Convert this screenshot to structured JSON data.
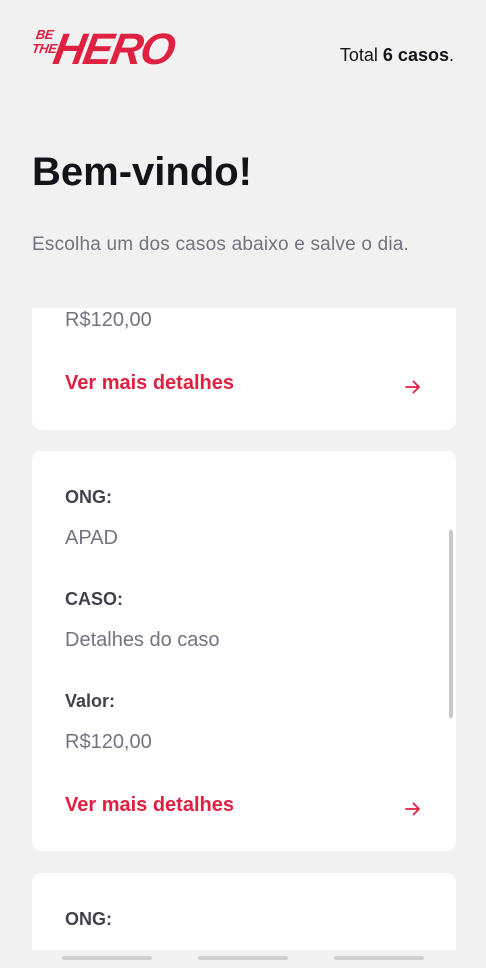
{
  "header": {
    "logo": {
      "be": "BE",
      "the": "THE",
      "hero": "HERO"
    },
    "total_prefix": "Total ",
    "total_count": "6 casos",
    "total_suffix": "."
  },
  "title": "Bem-vindo!",
  "subtitle": "Escolha um dos casos abaixo e salve o dia.",
  "cards": [
    {
      "value_amount": "R$120,00",
      "detail_label": "Ver mais detalhes"
    },
    {
      "ong_label": "ONG:",
      "ong": "APAD",
      "caso_label": "CASO:",
      "caso": "Detalhes do caso",
      "valor_label": "Valor:",
      "value_amount": "R$120,00",
      "detail_label": "Ver mais detalhes"
    },
    {
      "ong_label": "ONG:"
    }
  ],
  "colors": {
    "brand": "#e02041",
    "background": "#f1f1f1",
    "card": "#ffffff"
  }
}
